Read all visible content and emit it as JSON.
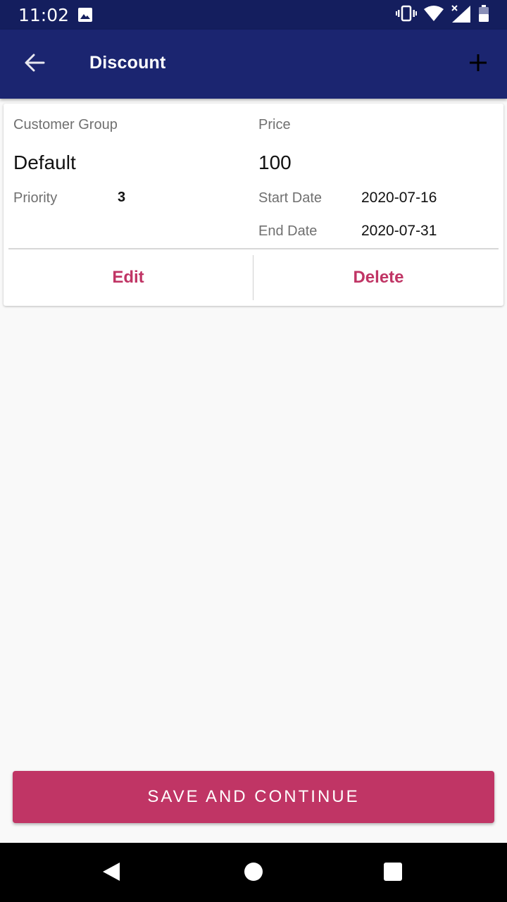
{
  "status_bar": {
    "time": "11:02",
    "icons": [
      "image-icon",
      "vibrate-icon",
      "wifi-icon",
      "signal-icon",
      "battery-icon"
    ]
  },
  "app_bar": {
    "title": "Discount",
    "icons": [
      "back-arrow-icon",
      "plus-icon"
    ]
  },
  "card": {
    "customer_group_label": "Customer Group",
    "customer_group_value": "Default",
    "price_label": "Price",
    "price_value": "100",
    "priority_label": "Priority",
    "priority_value": "3",
    "start_date_label": "Start Date",
    "start_date_value": "2020-07-16",
    "end_date_label": "End Date",
    "end_date_value": "2020-07-31",
    "edit_label": "Edit",
    "delete_label": "Delete"
  },
  "footer": {
    "save_label": "SAVE AND CONTINUE"
  },
  "nav_bar": {
    "icons": [
      "back-triangle-icon",
      "home-circle-icon",
      "recents-square-icon"
    ]
  },
  "colors": {
    "status_bar": "#141e5e",
    "app_bar": "#1b2570",
    "accent": "#c03565",
    "background": "#f9f9f9"
  }
}
